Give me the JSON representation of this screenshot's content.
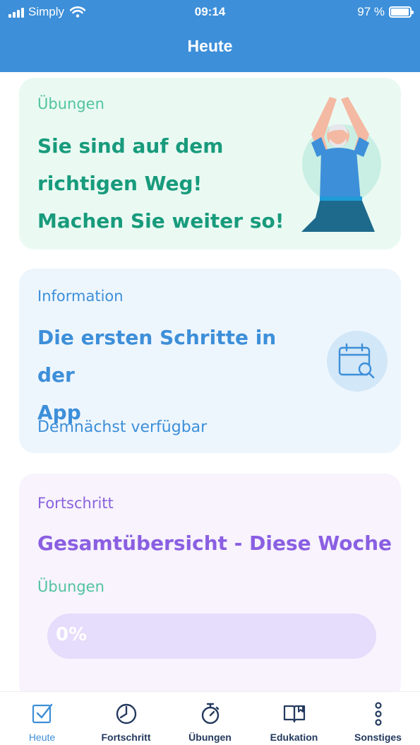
{
  "status_bar": {
    "carrier": "Simply",
    "time": "09:14",
    "battery_text": "97 %",
    "battery_level": 0.97
  },
  "header": {
    "title": "Heute"
  },
  "cards": {
    "exercise": {
      "label": "Übungen",
      "title_lines": [
        "Sie sind auf dem",
        "richtigen Weg!",
        "Machen Sie weiter so!"
      ],
      "illustration": "person-yoga-illustration"
    },
    "info": {
      "label": "Information",
      "title_lines": [
        "Die ersten Schritte in der",
        "App"
      ],
      "subtitle": "Demnächst verfügbar",
      "icon": "calendar-search-icon"
    },
    "progress": {
      "label": "Fortschritt",
      "title": "Gesamtübersicht - Diese Woche",
      "subtitle": "Übungen",
      "progress_value": 0,
      "progress_text": "0%"
    }
  },
  "tabs": [
    {
      "label": "Heute",
      "icon": "checkbox-icon",
      "active": true
    },
    {
      "label": "Fortschritt",
      "icon": "pie-chart-icon",
      "active": false
    },
    {
      "label": "Übungen",
      "icon": "stopwatch-icon",
      "active": false
    },
    {
      "label": "Edukation",
      "icon": "book-icon",
      "active": false
    },
    {
      "label": "Sonstiges",
      "icon": "more-vertical-icon",
      "active": false
    }
  ],
  "colors": {
    "header": "#3d8fd9",
    "exercise_accent": "#189b7c",
    "info_accent": "#3d8fd9",
    "progress_accent": "#8a5fe2",
    "tab_inactive": "#243a5e"
  }
}
